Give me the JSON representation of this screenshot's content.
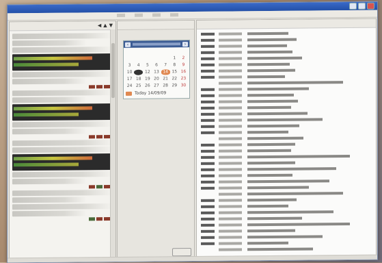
{
  "window": {
    "title": ""
  },
  "left_panel": {
    "header_text": "",
    "arrows": [
      "◀",
      "▲",
      "▼"
    ]
  },
  "calendar": {
    "weekdays": [
      "",
      "",
      "",
      "",
      "",
      "",
      ""
    ],
    "days": [
      "",
      "",
      "",
      "",
      "",
      "1",
      "2",
      "3",
      "4",
      "5",
      "6",
      "7",
      "8",
      "9",
      "10",
      "11",
      "12",
      "13",
      "14",
      "15",
      "16",
      "17",
      "18",
      "19",
      "20",
      "21",
      "22",
      "23",
      "24",
      "25",
      "26",
      "27",
      "28",
      "29",
      "30"
    ],
    "today_label": "Today 14/09/09",
    "accent": "#e08850",
    "header_color": "#3c5c94"
  },
  "middle_panel": {
    "button_label": ""
  },
  "log": {
    "rows": 36
  }
}
